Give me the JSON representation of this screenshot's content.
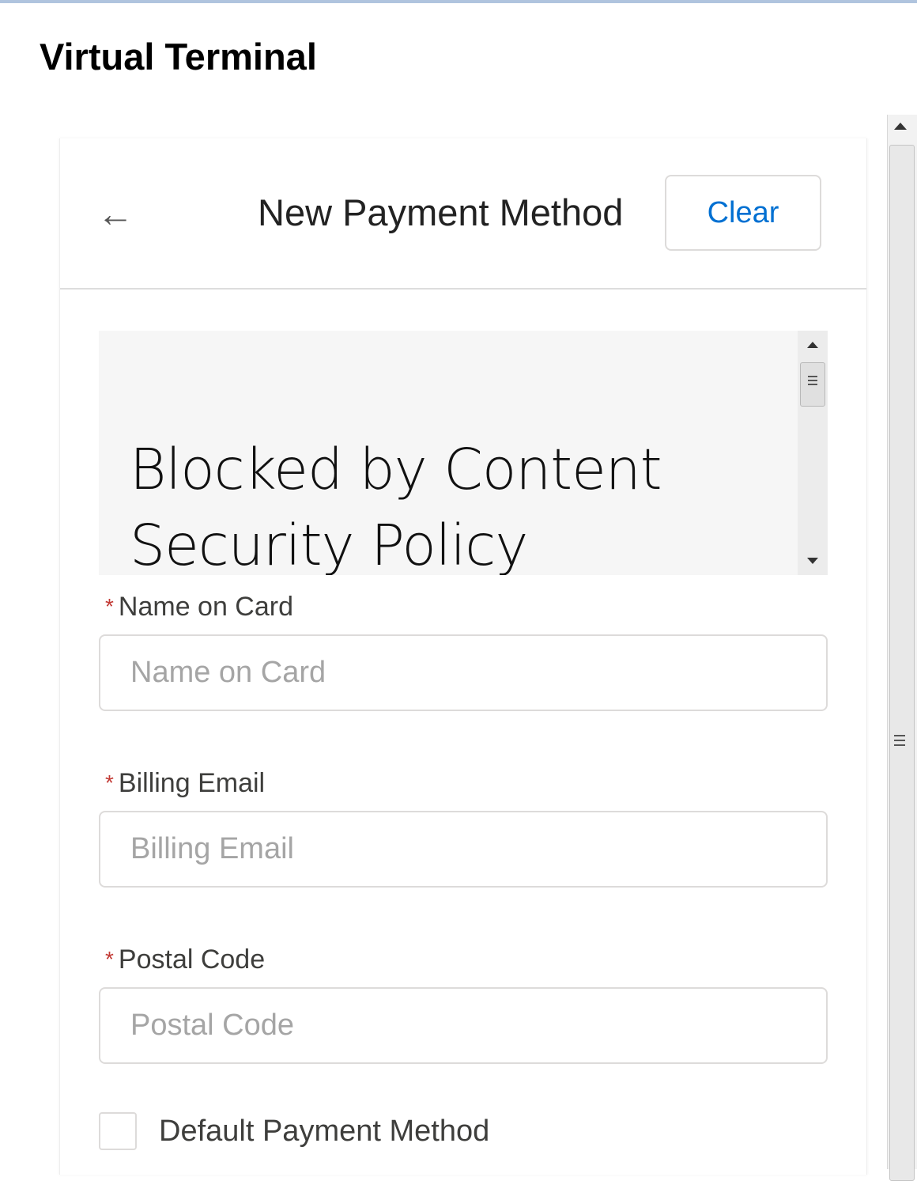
{
  "page": {
    "title": "Virtual Terminal"
  },
  "card": {
    "title": "New Payment Method",
    "back_icon": "arrow-left-icon",
    "clear_label": "Clear"
  },
  "blocked_frame": {
    "message": "Blocked by Content Security Policy"
  },
  "form": {
    "required_marker": "*",
    "name_on_card": {
      "label": "Name on Card",
      "placeholder": "Name on Card",
      "value": ""
    },
    "billing_email": {
      "label": "Billing Email",
      "placeholder": "Billing Email",
      "value": ""
    },
    "postal_code": {
      "label": "Postal Code",
      "placeholder": "Postal Code",
      "value": ""
    },
    "default_payment": {
      "label": "Default Payment Method",
      "checked": false
    }
  },
  "colors": {
    "accent": "#0070d2",
    "required": "#c23934",
    "border": "#dddbda",
    "placeholder": "#a5a5a5"
  }
}
